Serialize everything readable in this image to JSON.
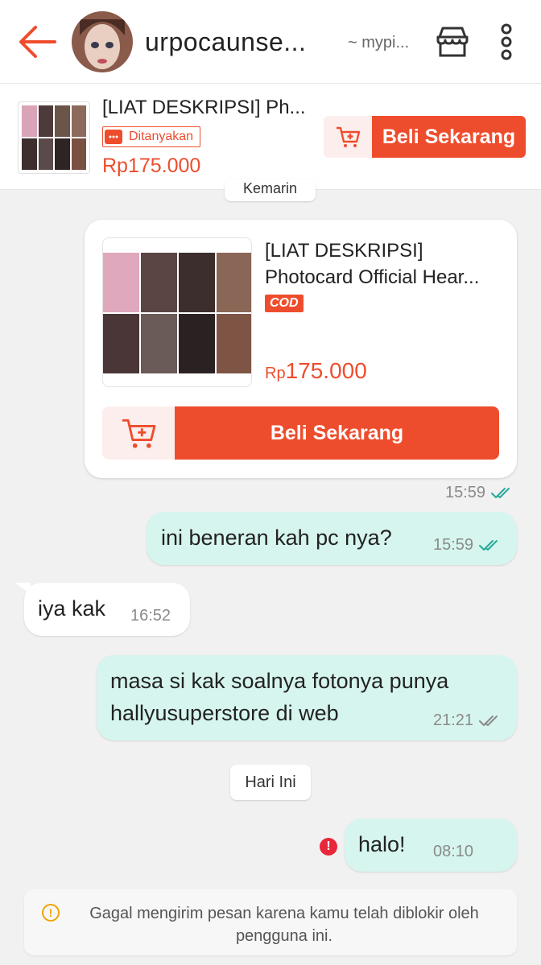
{
  "header": {
    "username": "urpocaunse...",
    "subname": "~ mypi...",
    "back_icon": "arrow-left-icon",
    "shop_icon": "shop-icon",
    "more_icon": "more-vertical-icon"
  },
  "product_bar": {
    "title": "[LIAT DESKRIPSI] Ph...",
    "badge": "Ditanyakan",
    "price": "Rp175.000",
    "buy_label": "Beli Sekarang",
    "cart_icon": "add-to-cart-icon"
  },
  "chat": {
    "partial_chip": "Kemarin",
    "product_card": {
      "title_line1": "[LIAT DESKRIPSI]",
      "title_line2": "Photocard Official Hear...",
      "cod": "COD",
      "price_currency": "Rp",
      "price_value": "175.000",
      "buy_label": "Beli Sekarang",
      "time": "15:59"
    },
    "messages": [
      {
        "direction": "out",
        "text": "ini beneran kah pc nya?",
        "time": "15:59",
        "read": true
      },
      {
        "direction": "in",
        "text": "iya kak",
        "time": "16:52"
      },
      {
        "direction": "out",
        "line1": "masa si kak soalnya fotonya punya",
        "line2": "hallyusuperstore di web",
        "time": "21:21",
        "read": false
      },
      {
        "direction": "out",
        "text": "halo!",
        "time": "08:10",
        "failed": true
      }
    ],
    "day_chip": "Hari Ini",
    "notice": "Gagal mengirim pesan karena kamu telah diblokir oleh pengguna ini."
  },
  "colors": {
    "brand": "#ee4d2d",
    "bubble_out": "#d6f5ee",
    "read_tick": "#26aa99",
    "error": "#e8273a"
  }
}
